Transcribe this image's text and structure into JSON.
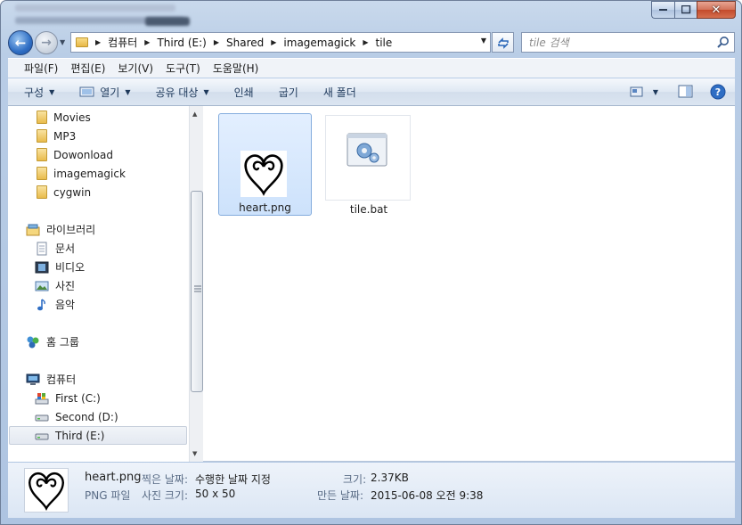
{
  "window": {
    "caption": {
      "minimize": "–",
      "maximize": "□",
      "close": "✕"
    }
  },
  "address": {
    "crumbs": [
      "컴퓨터",
      "Third (E:)",
      "Shared",
      "imagemagick",
      "tile"
    ]
  },
  "search": {
    "placeholder": "tile 검색"
  },
  "menu": [
    "파일(F)",
    "편집(E)",
    "보기(V)",
    "도구(T)",
    "도움말(H)"
  ],
  "commands": {
    "organize": "구성",
    "open": "열기",
    "share": "공유 대상",
    "print": "인쇄",
    "burn": "굽기",
    "new_folder": "새 폴더"
  },
  "tree": {
    "favorites_folders": [
      "Movies",
      "MP3",
      "Dowonload",
      "imagemagick",
      "cygwin"
    ],
    "libraries": "라이브러리",
    "library_items": [
      "문서",
      "비디오",
      "사진",
      "음악"
    ],
    "homegroup": "홈 그룹",
    "computer": "컴퓨터",
    "drives": [
      "First (C:)",
      "Second (D:)",
      "Third (E:)"
    ]
  },
  "files": [
    {
      "name": "heart.png",
      "selected": true
    },
    {
      "name": "tile.bat",
      "selected": false
    }
  ],
  "details": {
    "name": "heart.png",
    "type": "PNG 파일",
    "date_taken_label": "찍은 날짜:",
    "date_taken": "수행한 날짜 지정",
    "dimensions_label": "사진 크기:",
    "dimensions": "50 x 50",
    "size_label": "크기:",
    "size": "2.37KB",
    "created_label": "만든 날짜:",
    "created": "2015-06-08 오전 9:38"
  },
  "colors": {
    "selection": "#cde2fb",
    "accent": "#2f6ec4",
    "chrome": "#b9cde6"
  }
}
